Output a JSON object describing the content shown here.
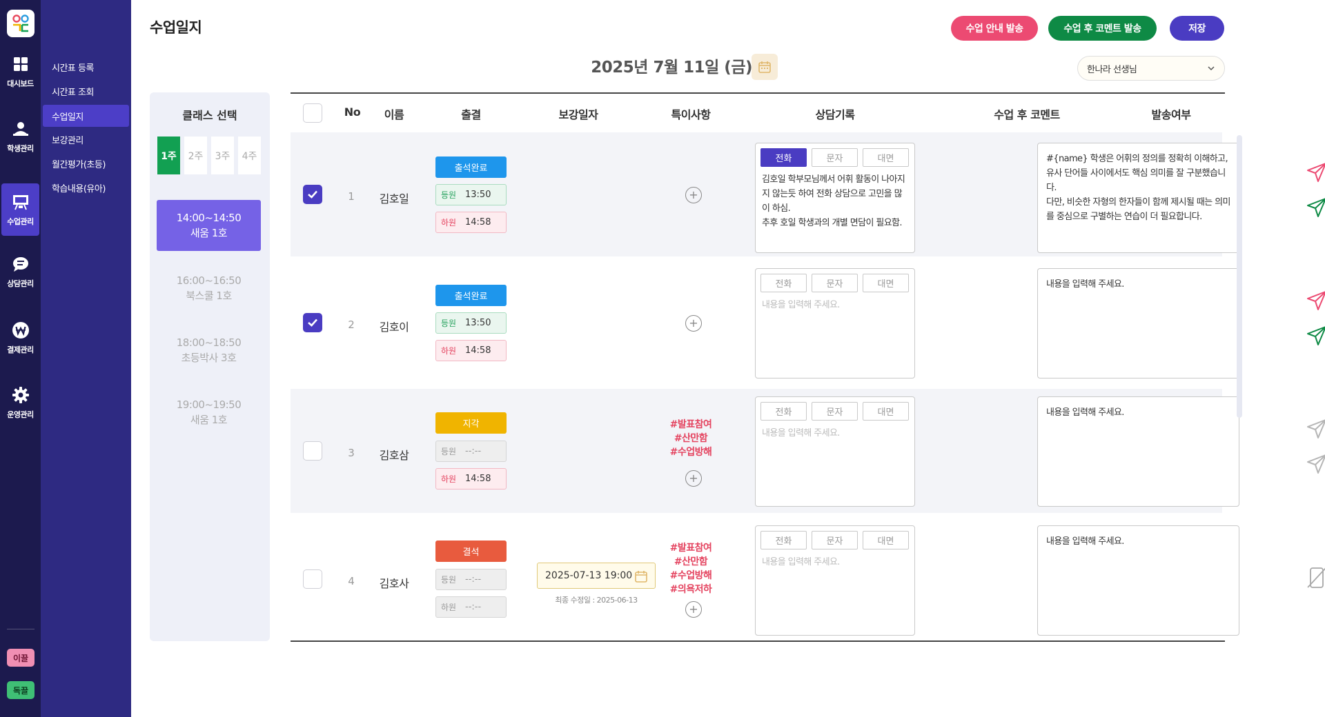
{
  "rail": {
    "items": [
      {
        "label": "대시보드",
        "icon": "dashboard-icon"
      },
      {
        "label": "학생관리",
        "icon": "person-icon"
      },
      {
        "label": "수업관리",
        "icon": "class-board-icon"
      },
      {
        "label": "상담관리",
        "icon": "chat-icon"
      },
      {
        "label": "결제관리",
        "icon": "won-icon"
      },
      {
        "label": "운영관리",
        "icon": "gear-icon"
      }
    ],
    "active": "수업관리",
    "badges": [
      {
        "label": "이끌",
        "color": "#f08fb3"
      },
      {
        "label": "독끌",
        "color": "#3fbf75"
      }
    ]
  },
  "submenu": {
    "items": [
      "시간표 등록",
      "시간표 조회",
      "수업일지",
      "보강관리",
      "월간평가(초등)",
      "학습내용(유아)"
    ],
    "active": "수업일지"
  },
  "header": {
    "title": "수업일지",
    "buttons": [
      {
        "label": "수업 안내 발송",
        "color": "#ec4a72"
      },
      {
        "label": "수업 후 코멘트 발송",
        "color": "#0e8a45"
      },
      {
        "label": "저장",
        "color": "#4a3cc2"
      }
    ],
    "date": "2025년 7월 11일 (금)",
    "teacher": "한나라 선생님"
  },
  "class_panel": {
    "title": "클래스 선택",
    "weeks": [
      "1주",
      "2주",
      "3주",
      "4주"
    ],
    "active_week": "1주",
    "slots": [
      {
        "time": "14:00~14:50",
        "room": "새움 1호",
        "active": true
      },
      {
        "time": "16:00~16:50",
        "room": "북스쿨 1호",
        "active": false
      },
      {
        "time": "18:00~18:50",
        "room": "초등박사 3호",
        "active": false
      },
      {
        "time": "19:00~19:50",
        "room": "새움 1호",
        "active": false
      }
    ]
  },
  "table": {
    "headers": [
      "No",
      "이름",
      "출결",
      "보강일자",
      "특이사항",
      "상담기록",
      "수업 후 코멘트",
      "발송여부"
    ],
    "consult_tabs": [
      "전화",
      "문자",
      "대면"
    ],
    "time_labels": {
      "in": "등원",
      "out": "하원"
    },
    "placeholder": "내용을 입력해 주세요.",
    "rows": [
      {
        "no": "1",
        "name": "김호일",
        "checked": true,
        "status": "출석완료",
        "status_color": "#1e96ec",
        "in_time": "13:50",
        "out_time": "14:58",
        "makeup_date": "",
        "makeup_note": "",
        "tags": [],
        "consult_tab": "전화",
        "consult": "김호일 학부모님께서 어휘 활동이 나아지지 않는듯 하여 전화 상담으로 고민을 많이 하심.\n추후 호일 학생과의 개별 면담이 필요함.",
        "comment": "#{name} 학생은 어휘의 정의를 정확히 이해하고, 유사 단어들 사이에서도 핵심 의미를 잘 구분했습니다.\n다만, 비슷한 자형의 한자들이 함께 제시될 때는 의미를 중심으로 구별하는 연습이 더 필요합니다.",
        "send": "sent"
      },
      {
        "no": "2",
        "name": "김호이",
        "checked": true,
        "status": "출석완료",
        "status_color": "#1e96ec",
        "in_time": "13:50",
        "out_time": "14:58",
        "makeup_date": "",
        "makeup_note": "",
        "tags": [],
        "consult_tab": "",
        "consult": "",
        "comment": "",
        "send": "sent"
      },
      {
        "no": "3",
        "name": "김호삼",
        "checked": false,
        "status": "지각",
        "status_color": "#f0b400",
        "in_time": "--:--",
        "out_time": "14:58",
        "makeup_date": "",
        "makeup_note": "",
        "tags": [
          "#발표참여",
          "#산만함",
          "#수업방해"
        ],
        "consult_tab": "",
        "consult": "",
        "comment": "",
        "send": "pending"
      },
      {
        "no": "4",
        "name": "김호사",
        "checked": false,
        "status": "결석",
        "status_color": "#e85b3e",
        "in_time": "--:--",
        "out_time": "--:--",
        "makeup_date": "2025-07-13 19:00",
        "makeup_note": "최종 수정일 : 2025-06-13",
        "tags": [
          "#발표참여",
          "#산만함",
          "#수업방해",
          "#의욕저하"
        ],
        "consult_tab": "",
        "consult": "",
        "comment": "",
        "send": "disabled"
      }
    ]
  }
}
